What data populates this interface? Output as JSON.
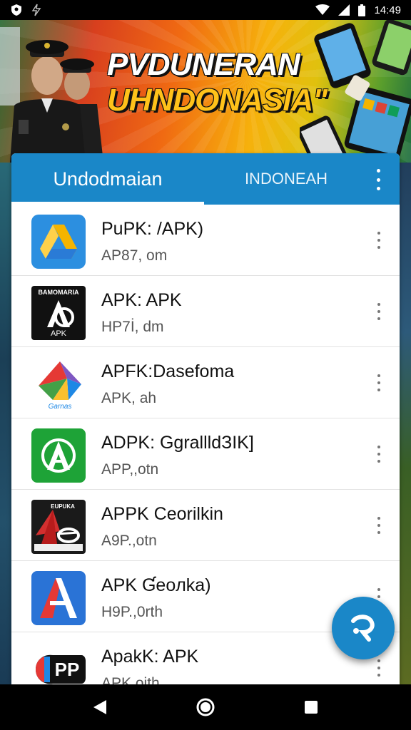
{
  "status_bar": {
    "time": "14:49",
    "icons": [
      "shield-icon",
      "bolt-icon",
      "wifi-icon",
      "signal-icon",
      "battery-icon"
    ]
  },
  "banner": {
    "title_line1": "PVDUNERAN",
    "title_line2": "UHNDONASIA\""
  },
  "tabs": [
    {
      "label": "Undodmaian",
      "active": true
    },
    {
      "label": "INDONEAH",
      "active": false
    }
  ],
  "apps": [
    {
      "name": "PuPK: /APK)",
      "size": "AP87, om",
      "icon": "drive-like-icon"
    },
    {
      "name": "APK: APK",
      "size": "HP7İ, dm",
      "icon": "black-a-logo-icon",
      "icon_text": "BAMOMARIA",
      "icon_sub": "APK"
    },
    {
      "name": "APFK:Dasefoma",
      "size": "APK, ah",
      "icon": "colorful-a-logo-icon",
      "icon_text": "Garnas"
    },
    {
      "name": "ADPK: GgrallldЗIK]",
      "size": "APP,,otn",
      "icon": "green-a-logo-icon"
    },
    {
      "name": "APPK Ceorilkin",
      "size": "A9P.,otn",
      "icon": "red-glasses-logo-icon",
      "icon_text": "EUPUKA"
    },
    {
      "name": "APK Ɠeoлka)",
      "size": "H9P.,0rth",
      "icon": "blue-a-logo-icon"
    },
    {
      "name": "ApakK: APK",
      "size": "APK,oith",
      "icon": "npp-logo-icon",
      "icon_text": "PP"
    }
  ],
  "colors": {
    "accent": "#1a87c8",
    "status_bar": "#000000"
  }
}
